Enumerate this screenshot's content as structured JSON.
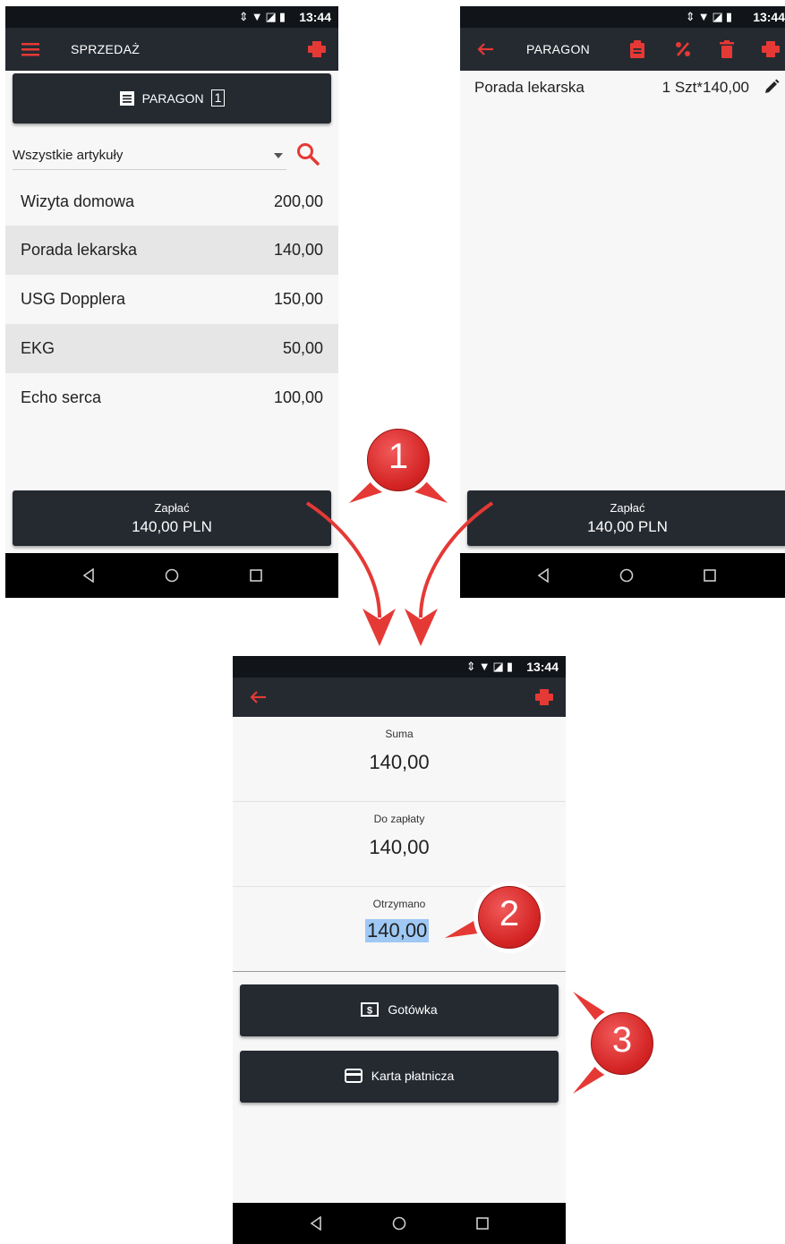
{
  "status_bar": {
    "time": "13:44"
  },
  "screen1": {
    "title": "SPRZEDAŻ",
    "receipt_button": {
      "label": "PARAGON",
      "count": "1"
    },
    "filter": {
      "selected": "Wszystkie artykuły"
    },
    "items": [
      {
        "name": "Wizyta domowa",
        "price": "200,00"
      },
      {
        "name": "Porada lekarska",
        "price": "140,00"
      },
      {
        "name": "USG Dopplera",
        "price": "150,00"
      },
      {
        "name": "EKG",
        "price": "50,00"
      },
      {
        "name": "Echo serca",
        "price": "100,00"
      }
    ],
    "pay_button": {
      "label": "Zapłać",
      "amount": "140,00 PLN"
    }
  },
  "screen2": {
    "title": "PARAGON",
    "line_item": {
      "name": "Porada lekarska",
      "qty_price": "1 Szt*140,00"
    },
    "pay_button": {
      "label": "Zapłać",
      "amount": "140,00 PLN"
    }
  },
  "screen3": {
    "sum": {
      "label": "Suma",
      "value": "140,00"
    },
    "to_pay": {
      "label": "Do zapłaty",
      "value": "140,00"
    },
    "received": {
      "label": "Otrzymano",
      "value": "140,00"
    },
    "cash_button": {
      "label": "Gotówka"
    },
    "card_button": {
      "label": "Karta płatnicza"
    }
  },
  "badges": [
    "1",
    "2",
    "3"
  ],
  "colors": {
    "accent": "#e53935",
    "toolbar": "#252a31",
    "statusbar": "#111418",
    "highlight": "#9fc8f4"
  }
}
